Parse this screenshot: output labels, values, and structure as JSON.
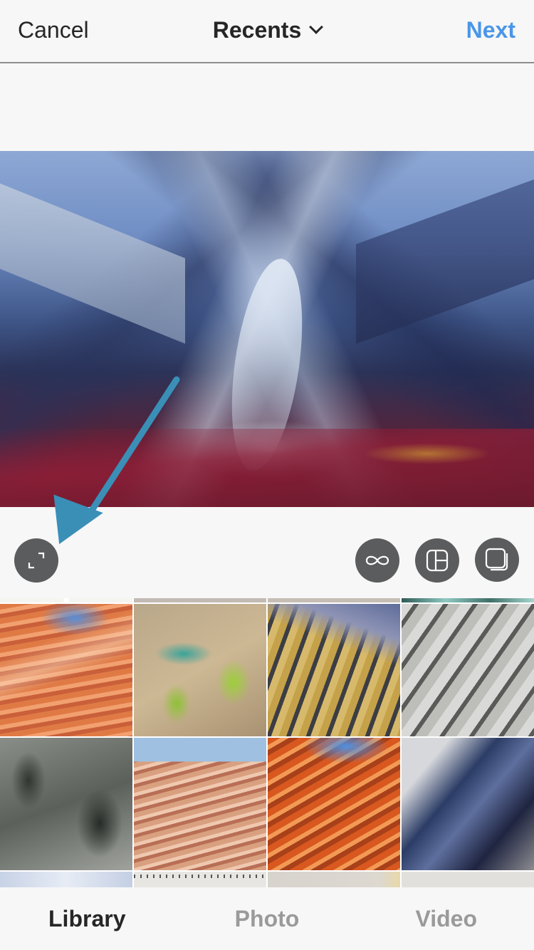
{
  "header": {
    "cancel_label": "Cancel",
    "title": "Recents",
    "next_label": "Next"
  },
  "colors": {
    "accent": "#4a96e8",
    "text_primary": "#262626",
    "text_inactive": "#9a9a9a",
    "button_bg": "#5b5c5e",
    "annotation_arrow": "#3a8fb7"
  },
  "preview": {
    "subject": "blue mountain valley with red tundra"
  },
  "toolbar": {
    "left": [
      {
        "name": "expand",
        "icon": "expand-icon"
      }
    ],
    "right": [
      {
        "name": "boomerang",
        "icon": "infinity-icon"
      },
      {
        "name": "layout",
        "icon": "layout-icon"
      },
      {
        "name": "select-multiple",
        "icon": "multiple-select-icon"
      }
    ]
  },
  "grid": {
    "rows": [
      [
        "partial-listing-1",
        "partial-listing-2",
        "partial-beige",
        "partial-teal"
      ],
      [
        "orange-sandstone-wave",
        "green-teal-highlands",
        "blue-ochre-ridges",
        "grey-eroded-hills"
      ],
      [
        "grey-rock-face",
        "pink-sandstone-wave",
        "red-orange-wave",
        "blue-mountain-shadow"
      ],
      [
        "pale-blue-frost",
        "sketchbook-page",
        "pencil-sketch",
        "printed-text-card"
      ]
    ]
  },
  "tabs": [
    {
      "label": "Library",
      "active": true
    },
    {
      "label": "Photo",
      "active": false
    },
    {
      "label": "Video",
      "active": false
    }
  ]
}
